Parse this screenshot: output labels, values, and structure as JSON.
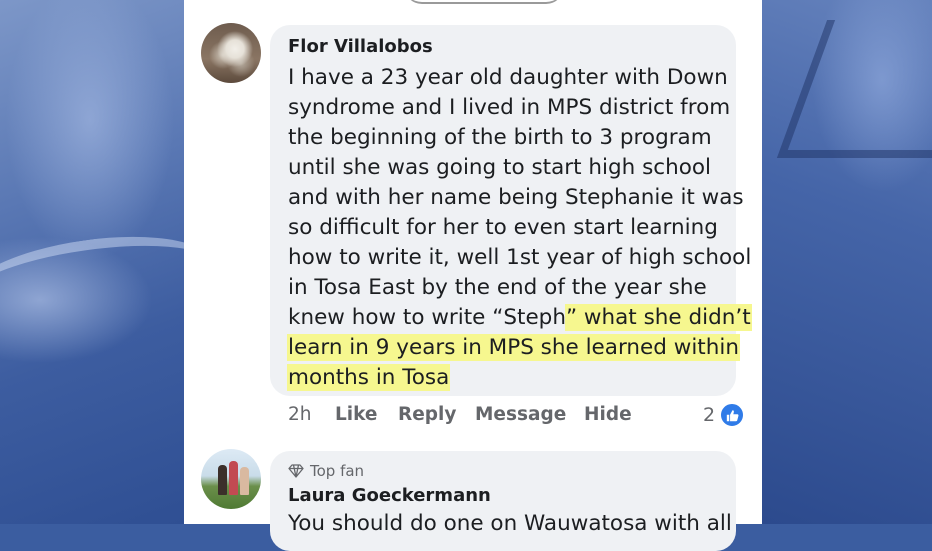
{
  "comment1": {
    "author": "Flor Villalobos",
    "lines": [
      "I have a 23 year old daughter with Down",
      "syndrome and I lived in MPS district from",
      "the beginning of the birth to 3 program",
      "until she was going to start high school",
      "and with her name being Stephanie it was",
      "so difficult for her to even start learning",
      "how to write it, well 1st year of high school",
      "in Tosa East by the end of the year she"
    ],
    "line9_plain": "knew how to write “Steph",
    "line9_highlight": "” what she didn’t",
    "line10_highlight": "learn in 9 years in MPS she learned within",
    "line11_highlight": "months in Tosa",
    "highlight_color": "#f6f78f",
    "time": "2h",
    "like_label": "Like",
    "reply_label": "Reply",
    "message_label": "Message",
    "hide_label": "Hide",
    "reaction_count": "2",
    "reaction_icon": "thumbs-up-icon"
  },
  "comment2": {
    "badge": "Top fan",
    "badge_icon": "diamond-icon",
    "author": "Laura Goeckermann",
    "partial_text": "You should do one on Wauwatosa with all"
  }
}
